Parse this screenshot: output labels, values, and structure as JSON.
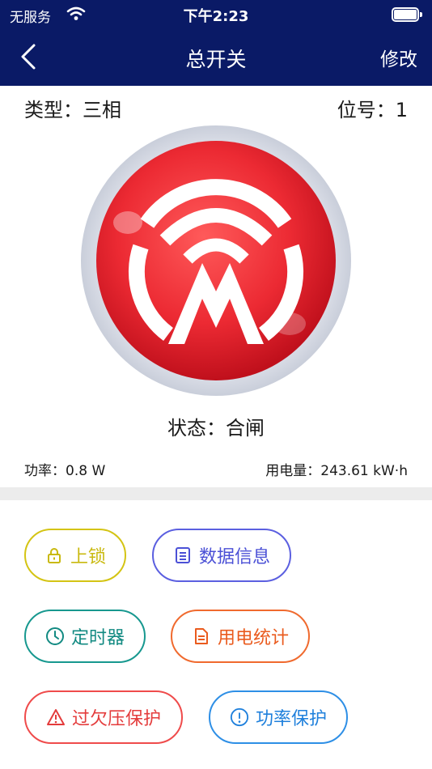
{
  "status_bar": {
    "carrier": "无服务",
    "time": "下午2:23"
  },
  "nav": {
    "title": "总开关",
    "edit_label": "修改"
  },
  "device": {
    "type_text": "类型：三相",
    "position_text": "位号：1",
    "state_text": "状态：合闸",
    "power_text": "功率：0.8 W",
    "energy_text": "用电量：243.61 kW·h"
  },
  "actions": {
    "lock": "上锁",
    "data_info": "数据信息",
    "timer": "定时器",
    "stats": "用电统计",
    "voltage_protection": "过欠压保护",
    "power_protection": "功率保护"
  },
  "colors": {
    "nav_bg": "#0a1a66",
    "switch_red": "#e8232f",
    "lock": "#d4c414",
    "data": "#5b5fe0",
    "timer": "#17988f",
    "stats": "#f06a2e",
    "voltage": "#ef4b4b",
    "power": "#2e8fe6"
  },
  "icons": {
    "wifi": "wifi-icon",
    "battery": "battery-icon",
    "back": "chevron-left-icon",
    "lock": "lock-icon",
    "data": "document-list-icon",
    "timer": "clock-icon",
    "stats": "document-icon",
    "voltage": "warning-triangle-icon",
    "power": "exclamation-circle-icon"
  }
}
